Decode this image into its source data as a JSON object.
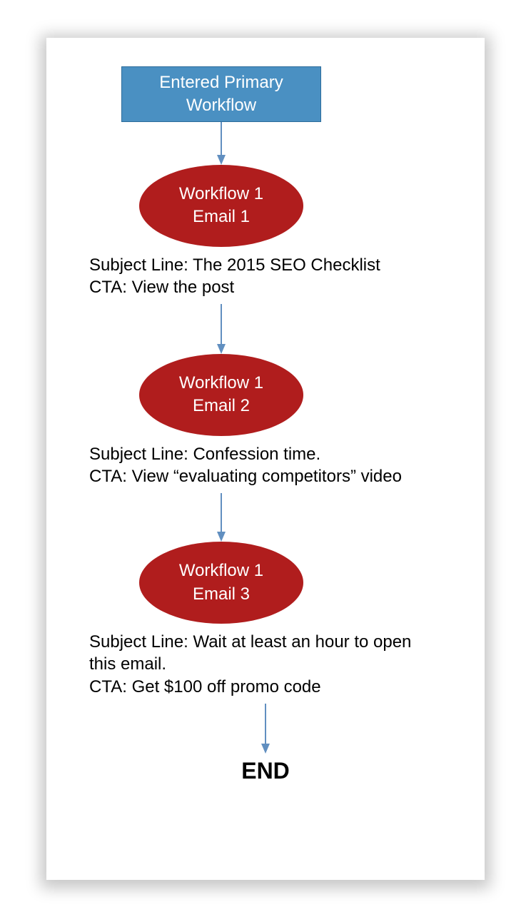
{
  "start": {
    "line1": "Entered Primary",
    "line2": "Workflow"
  },
  "node1": {
    "line1": "Workflow 1",
    "line2": "Email 1",
    "subjectLabel": "Subject Line: ",
    "subject": "The 2015 SEO Checklist",
    "ctaLabel": "CTA: ",
    "cta": "View the post"
  },
  "node2": {
    "line1": "Workflow 1",
    "line2": "Email 2",
    "subjectLabel": "Subject Line: ",
    "subject": "Confession time.",
    "ctaLabel": "CTA: ",
    "cta": "View “evaluating competitors” video"
  },
  "node3": {
    "line1": "Workflow 1",
    "line2": "Email 3",
    "subjectLabel": "Subject Line: ",
    "subject": "Wait at least an hour to open this email.",
    "ctaLabel": "CTA: ",
    "cta": "Get $100 off promo code"
  },
  "end": "END",
  "colors": {
    "startBox": "#4a90c2",
    "ellipse": "#b01d1d",
    "arrow": "#618fc0"
  }
}
